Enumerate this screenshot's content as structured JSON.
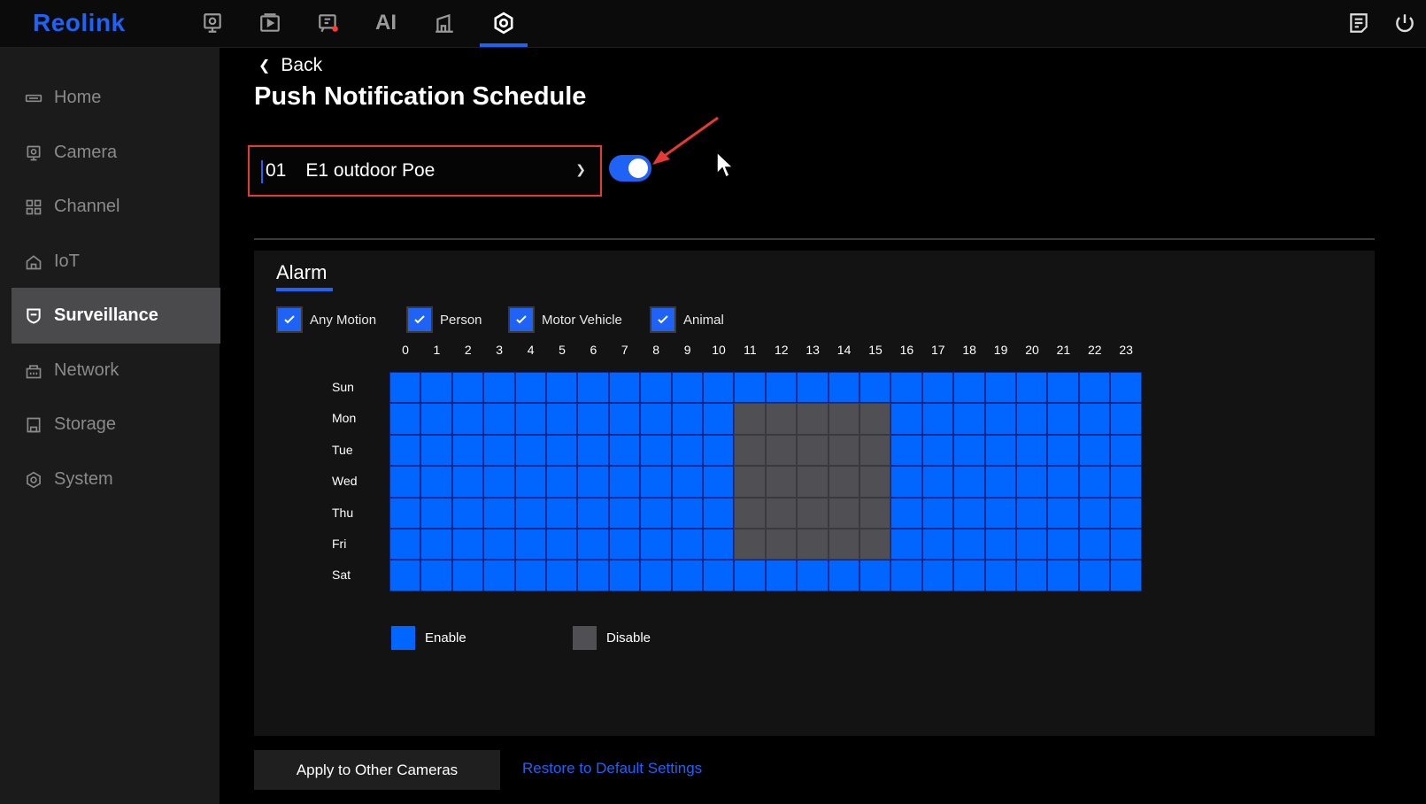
{
  "app": {
    "brand": "Reolink"
  },
  "topnav": {
    "items": [
      {
        "name": "monitor-icon",
        "active": false
      },
      {
        "name": "playback-icon",
        "active": false
      },
      {
        "name": "alert-icon",
        "active": false
      },
      {
        "name": "ai-icon",
        "label": "AI",
        "active": false
      },
      {
        "name": "device-icon",
        "active": false
      },
      {
        "name": "settings-icon",
        "active": true
      }
    ],
    "right": [
      "notes-icon",
      "power-icon"
    ]
  },
  "sidebar": {
    "items": [
      {
        "label": "Home",
        "icon": "home-icon",
        "active": false
      },
      {
        "label": "Camera",
        "icon": "camera-icon",
        "active": false
      },
      {
        "label": "Channel",
        "icon": "channel-icon",
        "active": false
      },
      {
        "label": "IoT",
        "icon": "iot-icon",
        "active": false
      },
      {
        "label": "Surveillance",
        "icon": "shield-icon",
        "active": true
      },
      {
        "label": "Network",
        "icon": "network-icon",
        "active": false
      },
      {
        "label": "Storage",
        "icon": "storage-icon",
        "active": false
      },
      {
        "label": "System",
        "icon": "system-icon",
        "active": false
      }
    ]
  },
  "page": {
    "back_label": "Back",
    "title": "Push Notification Schedule"
  },
  "camera_select": {
    "number": "01",
    "name": "E1 outdoor Poe"
  },
  "notification_toggle": {
    "on": true
  },
  "tabs": {
    "alarm": "Alarm"
  },
  "filters": [
    {
      "label": "Any Motion",
      "checked": true
    },
    {
      "label": "Person",
      "checked": true
    },
    {
      "label": "Motor Vehicle",
      "checked": true
    },
    {
      "label": "Animal",
      "checked": true
    }
  ],
  "schedule": {
    "hours": [
      "0",
      "1",
      "2",
      "3",
      "4",
      "5",
      "6",
      "7",
      "8",
      "9",
      "10",
      "11",
      "12",
      "13",
      "14",
      "15",
      "16",
      "17",
      "18",
      "19",
      "20",
      "21",
      "22",
      "23"
    ],
    "days": [
      "Sun",
      "Mon",
      "Tue",
      "Wed",
      "Thu",
      "Fri",
      "Sat"
    ],
    "disabled": {
      "Mon": [
        11,
        12,
        13,
        14,
        15
      ],
      "Tue": [
        11,
        12,
        13,
        14,
        15
      ],
      "Wed": [
        11,
        12,
        13,
        14,
        15
      ],
      "Thu": [
        11,
        12,
        13,
        14,
        15
      ],
      "Fri": [
        11,
        12,
        13,
        14,
        15
      ]
    },
    "colors": {
      "enable": "#0066ff",
      "disable": "#505054"
    }
  },
  "legend": {
    "enable": "Enable",
    "disable": "Disable"
  },
  "actions": {
    "apply": "Apply to Other Cameras",
    "restore": "Restore to Default Settings"
  }
}
